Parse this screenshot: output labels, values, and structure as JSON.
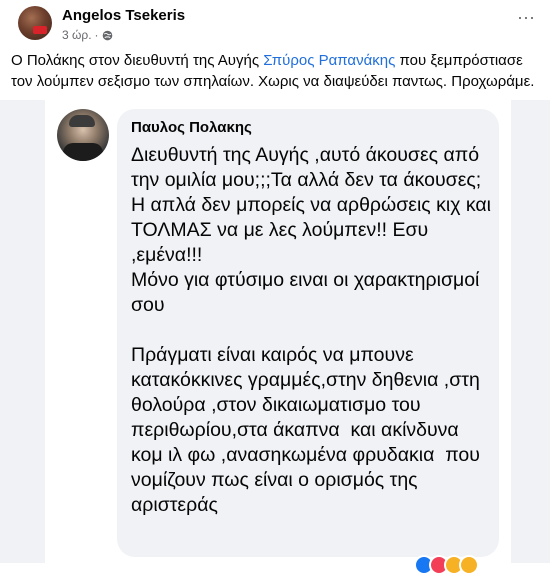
{
  "post": {
    "author": "Angelos Tsekeris",
    "time": "3 ώρ.",
    "separator": "·",
    "more": "···",
    "text_before": "Ο Πολάκης στον διευθυντή της Αυγής ",
    "link": "Σπύρος Ραπανάκης",
    "text_after": " που ξεμπρόστιασε τον λούμπεν σεξισμο των σπηλαίων. Χωρις να διαψεύδει παντως. Προχωράμε."
  },
  "image": {
    "commenter": "Παυλος Πολακης",
    "comment": "Διευθυντή της Αυγής ,αυτό άκουσες από την ομιλία μου;;;Τα αλλά δεν τα άκουσες; Η απλά δεν μπορείς να αρθρώσεις κιχ και ΤΟΛΜΑΣ να με λες λούμπεν!! Εσυ ,εμένα!!!\nΜόνο για φτύσιμο ειναι οι χαρακτηρισμοί σου\n\nΠράγματι είναι καιρός να μπουνε κατακόκκινες γραμμές,στην δηθενια ,στη θολούρα ,στον δικαιωματισμο του περιθωρίου,στα άκαπνα  και ακίνδυνα κομ ιλ φω ,ανασηκωμένα φρυδακια  που νομίζουν πως είναι ο ορισμός της αριστεράς"
  },
  "colors": {
    "link": "#216fdb",
    "bubble": "#f0f2f5",
    "meta": "#65676b"
  },
  "icons": [
    "globe-icon",
    "more-icon"
  ]
}
